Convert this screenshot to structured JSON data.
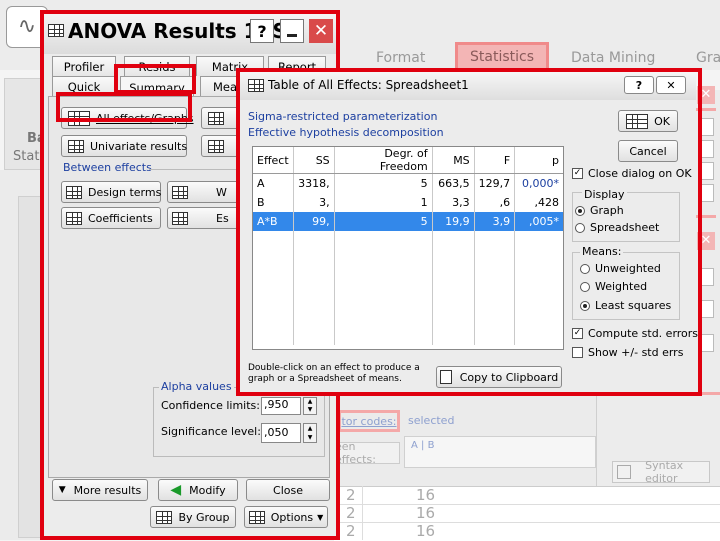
{
  "background": {
    "ribbon_tabs": [
      "Format",
      "Statistics",
      "Data Mining",
      "Gra"
    ],
    "left_button": [
      "Ba",
      "Stat"
    ],
    "factor_codes_link": "tor codes:",
    "factor_codes_value": "selected",
    "factor_codes_box": "A | B",
    "between_effects_btn": "een effects:",
    "syntax_editor": "Syntax editor",
    "sheet_rows": [
      {
        "a": "2",
        "b": "16"
      },
      {
        "a": "2",
        "b": "16"
      },
      {
        "a": "2",
        "b": "16"
      }
    ]
  },
  "anova": {
    "title": "ANOVA Results 1: S",
    "tabs_row1": [
      "Profiler",
      "Resids",
      "Matrix",
      "Report"
    ],
    "tabs_row2": [
      "Quick",
      "Summary",
      "Mea"
    ],
    "all_effects_graphs": "All effects/Graphs",
    "univariate_results": "Univariate results",
    "between_effects_label": "Between effects",
    "design_terms": "Design terms",
    "coefficients": "Coefficients",
    "partial_btn1": "W",
    "partial_btn2": "Es",
    "alpha_values_label": "Alpha values",
    "confidence_limits_label": "Confidence limits:",
    "confidence_limits_value": ",950",
    "significance_level_label": "Significance level:",
    "significance_level_value": ",050",
    "more_results": "More results",
    "modify": "Modify",
    "close": "Close",
    "by_group": "By Group",
    "options": "Options"
  },
  "effects": {
    "title": "Table of All Effects: Spreadsheet1",
    "info_line1": "Sigma-restricted parameterization",
    "info_line2": "Effective hypothesis decomposition",
    "columns": [
      "Effect",
      "SS",
      "Degr. of Freedom",
      "MS",
      "F",
      "p"
    ],
    "rows": [
      {
        "effect": "A",
        "ss": "3318,",
        "df": "5",
        "ms": "663,5",
        "f": "129,7",
        "p": "0,000*"
      },
      {
        "effect": "B",
        "ss": "3,",
        "df": "1",
        "ms": "3,3",
        "f": ",6",
        "p": ",428"
      },
      {
        "effect": "A*B",
        "ss": "99,",
        "df": "5",
        "ms": "19,9",
        "f": "3,9",
        "p": ",005*"
      }
    ],
    "hint": "Double-click on an effect to produce a graph or a Spreadsheet of means.",
    "copy_to_clipboard": "Copy to Clipboard",
    "ok": "OK",
    "cancel": "Cancel",
    "close_on_ok": "Close dialog on OK",
    "display_label": "Display",
    "display_graph": "Graph",
    "display_spreadsheet": "Spreadsheet",
    "means_label": "Means:",
    "means_unweighted": "Unweighted",
    "means_weighted": "Weighted",
    "means_least_squares": "Least squares",
    "compute_std_errors": "Compute std. errors",
    "show_std_errs": "Show +/- std errs"
  }
}
